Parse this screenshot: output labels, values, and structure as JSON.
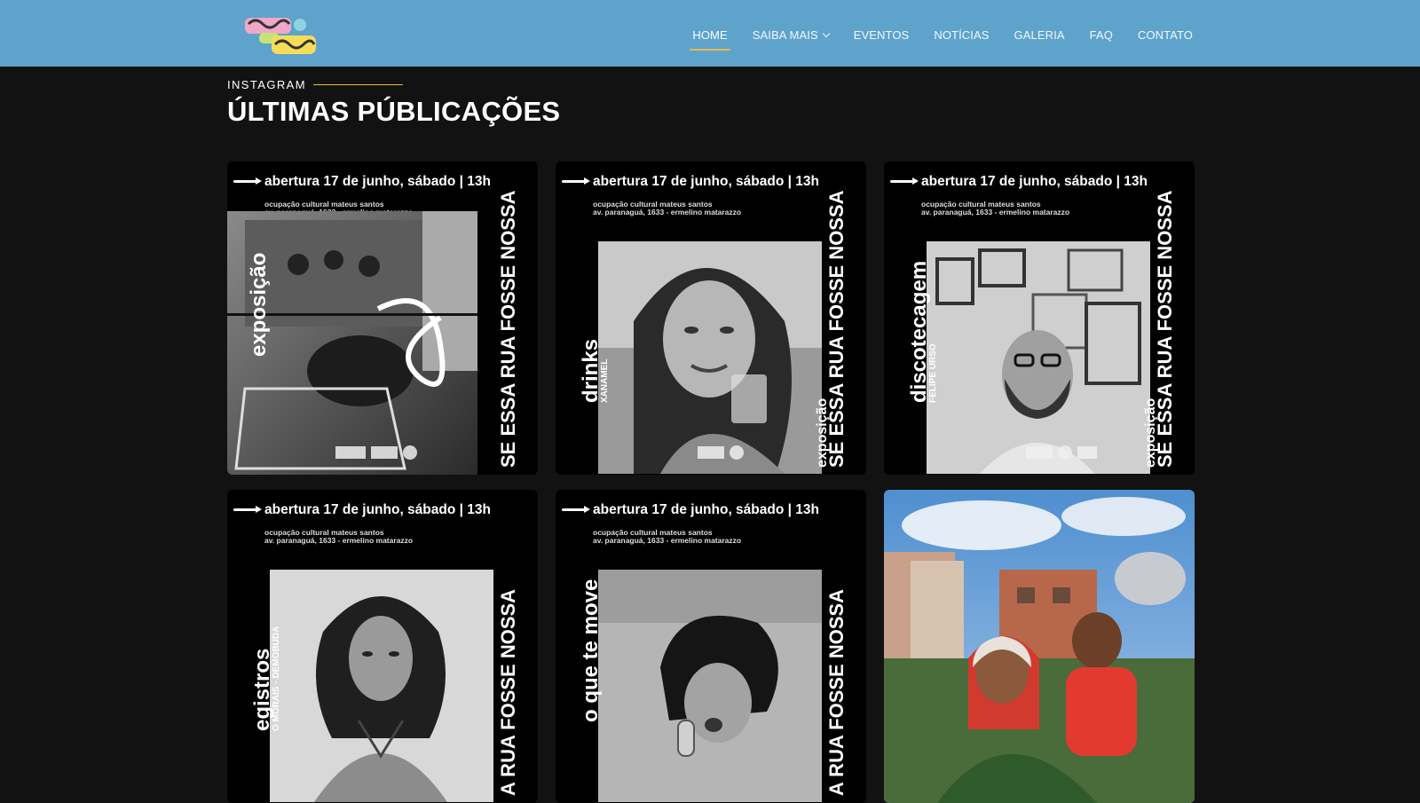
{
  "nav": {
    "items": [
      {
        "label": "HOME",
        "active": true
      },
      {
        "label": "SAIBA MAIS",
        "dropdown": true
      },
      {
        "label": "EVENTOS"
      },
      {
        "label": "NOTÍCIAS"
      },
      {
        "label": "GALERIA"
      },
      {
        "label": "FAQ"
      },
      {
        "label": "CONTATO"
      }
    ]
  },
  "section": {
    "kicker": "INSTAGRAM",
    "title": "ÚLTIMAS PÚBLICAÇÕES"
  },
  "posts": [
    {
      "headline": "abertura 17 de junho, sábado | 13h",
      "venue": "ocupação cultural mateus santos",
      "address": "av. paranaguá, 1633 - ermelino matarazzo",
      "side": "SE ESSA RUA FOSSE NOSSA",
      "main": "exposição",
      "sub": "",
      "tag": ""
    },
    {
      "headline": "abertura 17 de junho, sábado | 13h",
      "venue": "ocupação cultural mateus santos",
      "address": "av. paranaguá, 1633 - ermelino matarazzo",
      "side": "SE ESSA RUA FOSSE NOSSA",
      "main": "drinks",
      "sub": "XANAMEL",
      "tag": "exposição"
    },
    {
      "headline": "abertura 17 de junho, sábado | 13h",
      "venue": "ocupação cultural mateus santos",
      "address": "av. paranaguá, 1633 - ermelino matarazzo",
      "side": "SE ESSA RUA FOSSE NOSSA",
      "main": "discotecagem",
      "sub": "FELIPE URSO",
      "tag": "exposição"
    },
    {
      "headline": "abertura 17 de junho, sábado | 13h",
      "venue": "ocupação cultural mateus santos",
      "address": "av. paranaguá, 1633 - ermelino matarazzo",
      "side": "A RUA FOSSE NOSSA",
      "main": "egistros",
      "sub": "O MORAIS - DEMOBUDA",
      "tag": ""
    },
    {
      "headline": "abertura 17 de junho, sábado | 13h",
      "venue": "ocupação cultural mateus santos",
      "address": "av. paranaguá, 1633 - ermelino matarazzo",
      "side": "A RUA FOSSE NOSSA",
      "main": "o que te move",
      "sub": "",
      "tag": ""
    }
  ],
  "colors": {
    "navbar": "#5ea3cb",
    "background": "#121212",
    "accent": "#e9b84a"
  }
}
